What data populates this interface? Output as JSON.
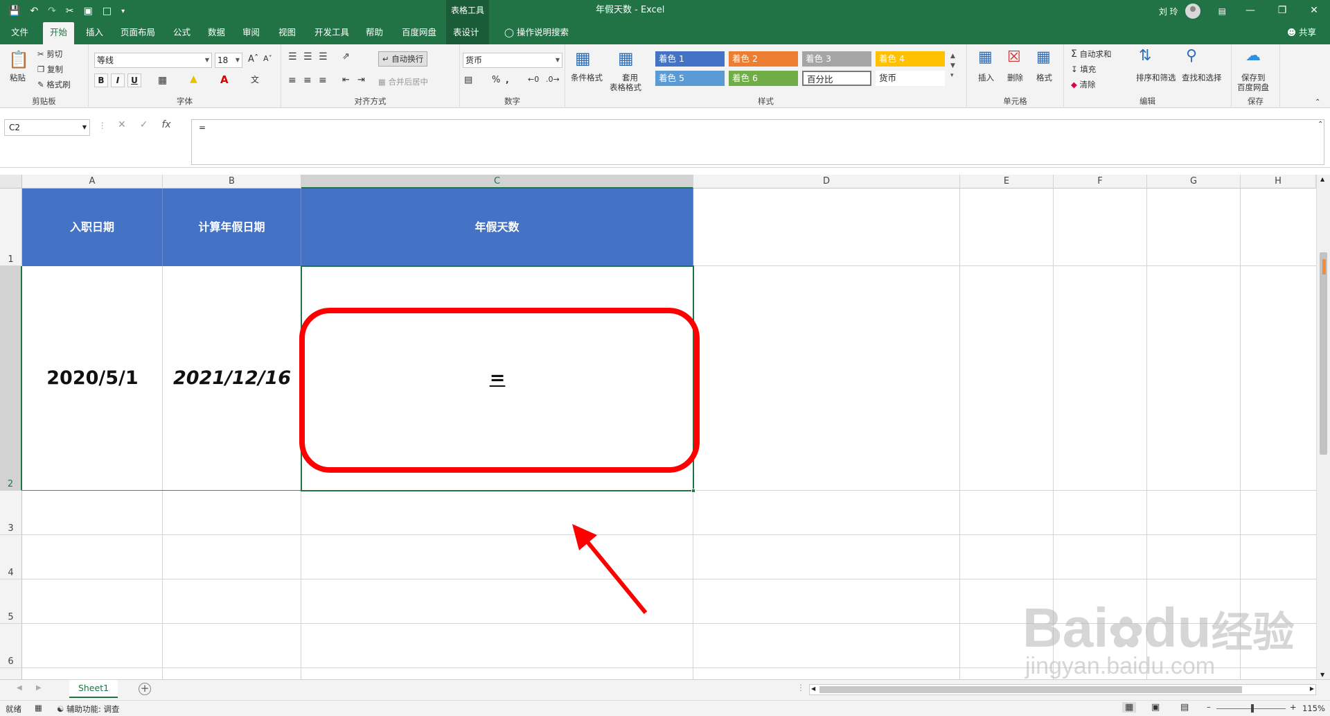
{
  "app": {
    "title": "年假天数  -  Excel",
    "context_tools": "表格工具",
    "user": "刘 玲",
    "share": "共享",
    "tell_me": "操作说明搜索"
  },
  "tabs": [
    "文件",
    "开始",
    "插入",
    "页面布局",
    "公式",
    "数据",
    "审阅",
    "视图",
    "开发工具",
    "帮助",
    "百度网盘",
    "表设计"
  ],
  "ribbon": {
    "clipboard": {
      "label": "剪贴板",
      "paste": "粘贴",
      "cut": "剪切",
      "copy": "复制",
      "format_painter": "格式刷"
    },
    "font": {
      "label": "字体",
      "name": "等线",
      "size": "18"
    },
    "alignment": {
      "label": "对齐方式",
      "wrap": "自动换行",
      "merge": "合并后居中"
    },
    "number": {
      "label": "数字",
      "format": "货币"
    },
    "styles": {
      "label": "样式",
      "conditional": "条件格式",
      "table_format_line1": "套用",
      "table_format_line2": "表格格式",
      "cells": [
        {
          "label": "着色 1",
          "color": "#4472c4"
        },
        {
          "label": "着色 2",
          "color": "#ed7d31"
        },
        {
          "label": "着色 3",
          "color": "#a5a5a5"
        },
        {
          "label": "着色 4",
          "color": "#ffc000"
        },
        {
          "label": "着色 5",
          "color": "#5b9bd5"
        },
        {
          "label": "着色 6",
          "color": "#70ad47"
        },
        {
          "label": "百分比",
          "color": "#ffffff"
        },
        {
          "label": "货币",
          "color": "#ffffff"
        }
      ]
    },
    "cells": {
      "label": "单元格",
      "insert": "插入",
      "delete": "删除",
      "format": "格式"
    },
    "editing": {
      "label": "编辑",
      "autosum": "自动求和",
      "fill": "填充",
      "clear": "清除",
      "sort_filter": "排序和筛选",
      "find_select": "查找和选择"
    },
    "save": {
      "label": "保存",
      "save_line1": "保存到",
      "save_line2": "百度网盘"
    }
  },
  "formula_bar": {
    "name_box": "C2",
    "formula": "="
  },
  "columns": [
    "A",
    "B",
    "C",
    "D",
    "E",
    "F",
    "G",
    "H"
  ],
  "rows": [
    "1",
    "2",
    "3",
    "4",
    "5",
    "6"
  ],
  "cells": {
    "A1": "入职日期",
    "B1": "计算年假日期",
    "C1": "年假天数",
    "A2": "2020/5/1",
    "B2": "2021/12/16",
    "C2": "="
  },
  "sheet": {
    "tab": "Sheet1"
  },
  "status": {
    "ready": "就绪",
    "accessibility": "辅助功能: 调查",
    "zoom": "115%"
  },
  "watermark": {
    "logo": "Bai",
    "logo2": "du",
    "logo3": "经验",
    "url": "jingyan.baidu.com"
  }
}
